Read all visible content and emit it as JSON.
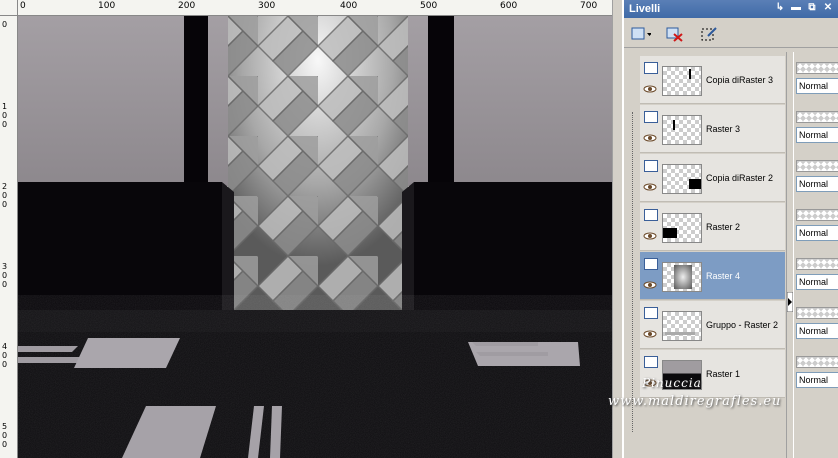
{
  "ruler": {
    "top_labels": [
      "0",
      "100",
      "200",
      "300",
      "400",
      "500",
      "600",
      "700"
    ],
    "left_labels": [
      "0",
      "100",
      "200",
      "300",
      "400",
      "500"
    ]
  },
  "panel": {
    "title": "Livelli",
    "title_buttons": [
      "pin-icon",
      "minimize-icon",
      "restore-icon",
      "close-icon"
    ],
    "toolbar": [
      "new-layer-icon",
      "delete-layer-icon",
      "edit-selection-icon"
    ]
  },
  "layers": [
    {
      "name": "Copia diRaster 3",
      "selected": false,
      "blend": "Normal"
    },
    {
      "name": "Raster 3",
      "selected": false,
      "blend": "Normal"
    },
    {
      "name": "Copia diRaster 2",
      "selected": false,
      "blend": "Normal"
    },
    {
      "name": "Raster 2",
      "selected": false,
      "blend": "Normal"
    },
    {
      "name": "Raster 4",
      "selected": true,
      "blend": "Normal"
    },
    {
      "name": "Gruppo - Raster 2",
      "selected": false,
      "blend": "Normal"
    },
    {
      "name": "Raster 1",
      "selected": false,
      "blend": "Normal"
    }
  ],
  "watermark": {
    "line1": "Pinuccia",
    "line2": "www.maldiregrafles.eu"
  },
  "colors": {
    "title_bar": "#3f6aa7",
    "selected_row": "#7d9cc4"
  }
}
